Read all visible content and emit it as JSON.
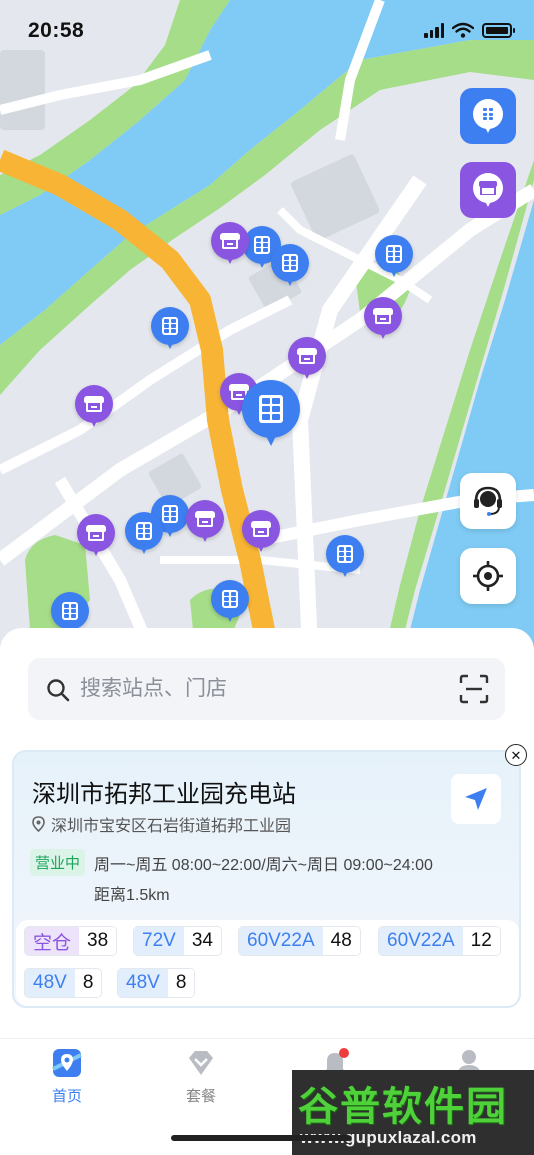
{
  "status_bar": {
    "time": "20:58"
  },
  "map": {
    "right_buttons": [
      {
        "name": "station-filter",
        "icon": "charging-station-pin-icon"
      },
      {
        "name": "store-filter",
        "icon": "store-pin-icon"
      },
      {
        "name": "customer-service",
        "icon": "headset-icon"
      },
      {
        "name": "locate-me",
        "icon": "crosshair-icon"
      }
    ],
    "colors": {
      "water": "#7fcbf5",
      "park": "#a6dd88",
      "land": "#e4e8ee",
      "road": "#ffffff",
      "highway": "#f8b535",
      "station_pin": "#3d7ff0",
      "store_pin": "#8a55e0"
    }
  },
  "search": {
    "placeholder": "搜索站点、门店"
  },
  "station": {
    "name": "深圳市拓邦工业园充电站",
    "address": "深圳市宝安区石岩街道拓邦工业园",
    "status": "营业中",
    "hours": "周一~周五 08:00~22:00/周六~周日 09:00~24:00",
    "distance": "距离1.5km",
    "ports": [
      {
        "label": "空仓",
        "count": "38",
        "kind": "free"
      },
      {
        "label": "72V",
        "count": "34",
        "kind": "volt"
      },
      {
        "label": "60V22A",
        "count": "48",
        "kind": "volt"
      },
      {
        "label": "60V22A",
        "count": "12",
        "kind": "volt"
      },
      {
        "label": "48V",
        "count": "8",
        "kind": "volt"
      },
      {
        "label": "48V",
        "count": "8",
        "kind": "volt"
      }
    ]
  },
  "tabs": [
    {
      "label": "首页",
      "active": true
    },
    {
      "label": "套餐",
      "active": false
    }
  ],
  "watermark": {
    "title": "谷普软件园",
    "url": "www.gupuxlazal.com"
  }
}
